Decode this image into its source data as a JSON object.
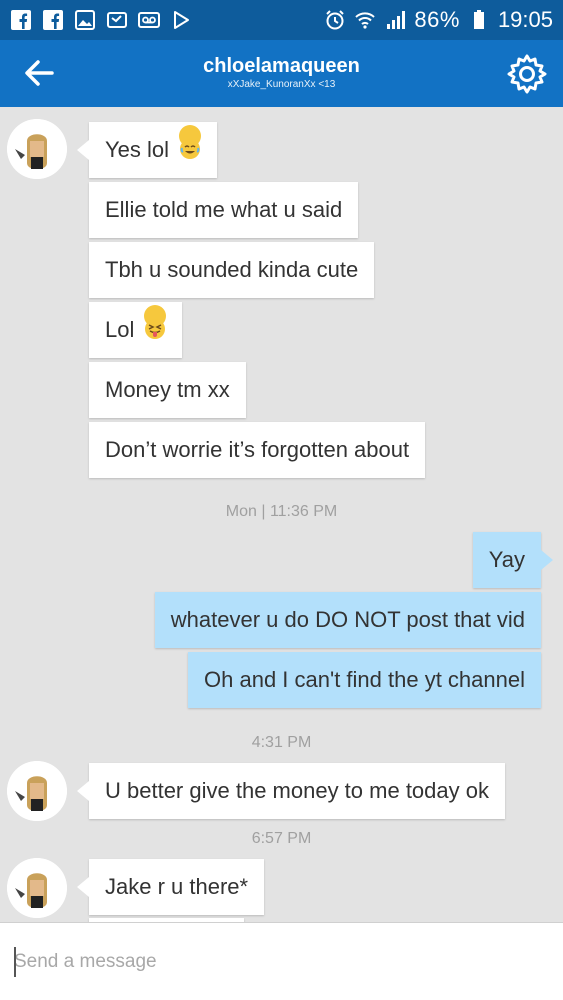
{
  "status_bar": {
    "icons": [
      "facebook-icon",
      "facebook-icon",
      "gallery-icon",
      "missed-call-icon",
      "voicemail-icon",
      "play-store-icon",
      "alarm-icon",
      "wifi-icon",
      "signal-icon",
      "battery-icon"
    ],
    "battery": "86%",
    "time": "19:05"
  },
  "header": {
    "title": "chloelamaqueen",
    "subtitle": "xXJake_KunoranXx <13",
    "back_icon": "arrow-left-icon",
    "settings_icon": "gear-icon"
  },
  "colors": {
    "status_bar": "#0e5c9c",
    "app_bar": "#1272c4",
    "background": "#e3e3e3",
    "incoming_bubble": "#ffffff",
    "outgoing_bubble": "#b3e0fb",
    "timestamp": "#a0a0a0"
  },
  "messages": {
    "m1": "Yes lol",
    "m2": "Ellie told me what u said",
    "m3": "Tbh u sounded kinda cute",
    "m4": "Lol",
    "m5": "Money tm xx",
    "m6": "Don’t worrie it’s forgotten about",
    "ts1": "Mon | 11:36 PM",
    "m7": "Yay",
    "m8": "whatever u do DO NOT post that vid",
    "m9": "Oh and I can't find the yt channel",
    "ts2": "4:31 PM",
    "m10": "U better give the money to me today ok",
    "ts3": "6:57 PM",
    "m11": "Jake r u there*"
  },
  "emojis": {
    "m1": "tears-of-joy-emoji",
    "m4": "squinting-tongue-emoji"
  },
  "composer": {
    "placeholder": "Send a message",
    "value": ""
  }
}
